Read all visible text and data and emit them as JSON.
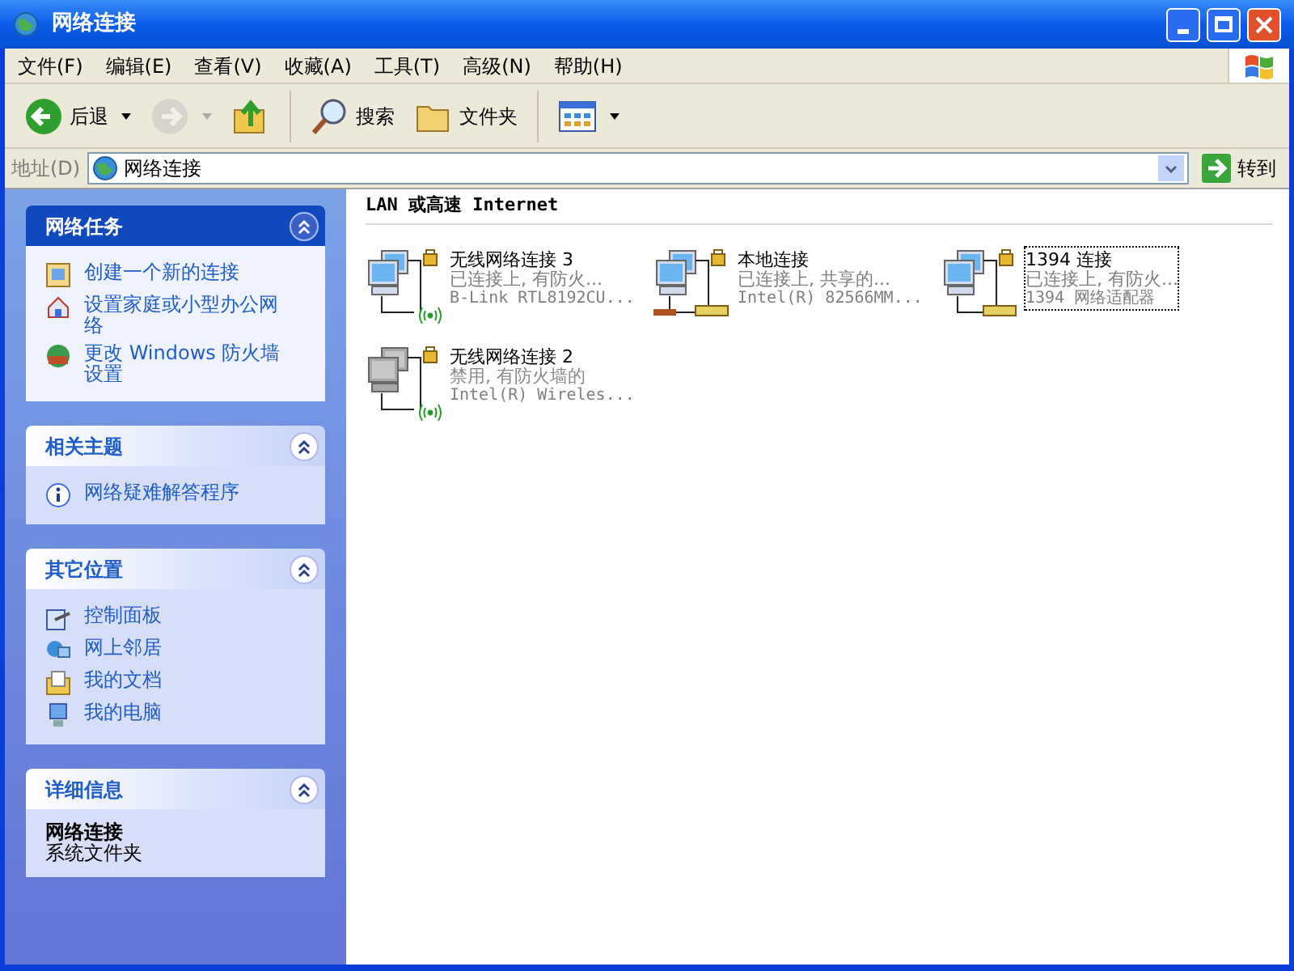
{
  "window": {
    "title": "网络连接"
  },
  "menu": [
    "文件(F)",
    "编辑(E)",
    "查看(V)",
    "收藏(A)",
    "工具(T)",
    "高级(N)",
    "帮助(H)"
  ],
  "toolbar": [
    {
      "kind": "back",
      "label": "后退",
      "disabled": false
    },
    {
      "kind": "forward",
      "disabled": true
    },
    {
      "kind": "up",
      "disabled": false
    },
    {
      "kind": "search",
      "label": "搜索",
      "disabled": false
    },
    {
      "kind": "folders",
      "label": "文件夹",
      "disabled": false
    },
    {
      "kind": "views",
      "disabled": false
    }
  ],
  "address": {
    "label": "地址(D)",
    "value": "网络连接",
    "go": "转到"
  },
  "panels": [
    {
      "title": "网络任务",
      "kind": "special",
      "expanded": true,
      "items": [
        {
          "kind": "new",
          "label": "创建一个新的连接"
        },
        {
          "kind": "home",
          "label": "设置家庭或小型办公网络"
        },
        {
          "kind": "firewall",
          "label": "更改 Windows 防火墙设置"
        }
      ]
    },
    {
      "title": "相关主题",
      "kind": "normal",
      "expanded": true,
      "items": [
        {
          "kind": "info",
          "label": "网络疑难解答程序"
        }
      ]
    },
    {
      "title": "其它位置",
      "kind": "normal",
      "expanded": true,
      "items": [
        {
          "kind": "control",
          "label": "控制面板"
        },
        {
          "kind": "network",
          "label": "网上邻居"
        },
        {
          "kind": "docs",
          "label": "我的文档"
        },
        {
          "kind": "computer",
          "label": "我的电脑"
        }
      ]
    },
    {
      "title": "详细信息",
      "kind": "details",
      "expanded": true,
      "name": "网络连接",
      "subtitle": "系统文件夹"
    }
  ],
  "group": {
    "title": "LAN 或高速 Internet"
  },
  "connections": [
    {
      "kind": "wireless",
      "name": "无线网络连接 3",
      "status": "已连接上, 有防火...",
      "device": "B-Link RTL8192CU...",
      "disabled": false,
      "selected": false
    },
    {
      "kind": "local",
      "name": "本地连接",
      "status": "已连接上, 共享的...",
      "device": "Intel(R) 82566MM...",
      "disabled": false,
      "selected": false
    },
    {
      "kind": "local1394",
      "name": "1394 连接",
      "status": "已连接上, 有防火...",
      "device": "1394 网络适配器",
      "disabled": false,
      "selected": true
    },
    {
      "kind": "wireless",
      "name": "无线网络连接 2",
      "status": "禁用, 有防火墙的",
      "device": "Intel(R) Wireles...",
      "disabled": true,
      "selected": false
    }
  ]
}
